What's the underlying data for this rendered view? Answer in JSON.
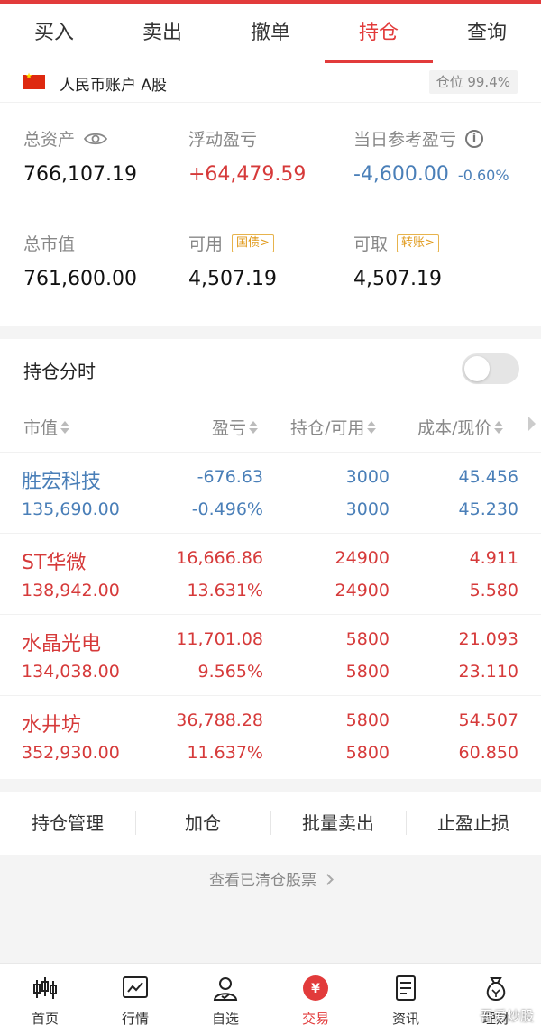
{
  "tabs": [
    {
      "label": "买入"
    },
    {
      "label": "卖出"
    },
    {
      "label": "撤单"
    },
    {
      "label": "持仓",
      "active": true
    },
    {
      "label": "查询"
    }
  ],
  "account": {
    "name": "人民币账户 A股",
    "position_ratio": "仓位 99.4%",
    "total_assets_label": "总资产",
    "total_assets": "766,107.19",
    "floating_pl_label": "浮动盈亏",
    "floating_pl": "+64,479.59",
    "daily_pl_label": "当日参考盈亏",
    "daily_pl": "-4,600.00",
    "daily_pl_pct": "-0.60%",
    "market_value_label": "总市值",
    "market_value": "761,600.00",
    "available_label": "可用",
    "available_tag": "国债>",
    "available": "4,507.19",
    "withdrawable_label": "可取",
    "withdrawable_tag": "转账>",
    "withdrawable": "4,507.19"
  },
  "holdings": {
    "split_label": "持仓分时",
    "columns": [
      "市值",
      "盈亏",
      "持仓/可用",
      "成本/现价"
    ],
    "rows": [
      {
        "name": "胜宏科技",
        "market_value": "135,690.00",
        "pl": "-676.63",
        "pl_pct": "-0.496%",
        "position": "3000",
        "available": "3000",
        "cost": "45.456",
        "price": "45.230",
        "trend": "down"
      },
      {
        "name": "ST华微",
        "market_value": "138,942.00",
        "pl": "16,666.86",
        "pl_pct": "13.631%",
        "position": "24900",
        "available": "24900",
        "cost": "4.911",
        "price": "5.580",
        "trend": "up"
      },
      {
        "name": "水晶光电",
        "market_value": "134,038.00",
        "pl": "11,701.08",
        "pl_pct": "9.565%",
        "position": "5800",
        "available": "5800",
        "cost": "21.093",
        "price": "23.110",
        "trend": "up"
      },
      {
        "name": "水井坊",
        "market_value": "352,930.00",
        "pl": "36,788.28",
        "pl_pct": "11.637%",
        "position": "5800",
        "available": "5800",
        "cost": "54.507",
        "price": "60.850",
        "trend": "up"
      }
    ]
  },
  "actions": [
    "持仓管理",
    "加仓",
    "批量卖出",
    "止盈止损"
  ],
  "cleared_link": "查看已清仓股票",
  "bottom_nav": [
    {
      "label": "首页",
      "icon": "candlestick-icon"
    },
    {
      "label": "行情",
      "icon": "chart-icon"
    },
    {
      "label": "自选",
      "icon": "user-icon"
    },
    {
      "label": "交易",
      "icon": "yuan-icon",
      "active": true
    },
    {
      "label": "资讯",
      "icon": "document-icon"
    },
    {
      "label": "理财",
      "icon": "money-bag-icon"
    }
  ],
  "watermark": "吾爱炒股",
  "colors": {
    "accent": "#e23b3b",
    "up": "#d63a3a",
    "down": "#4a7fb8",
    "tag": "#e09a1c"
  }
}
